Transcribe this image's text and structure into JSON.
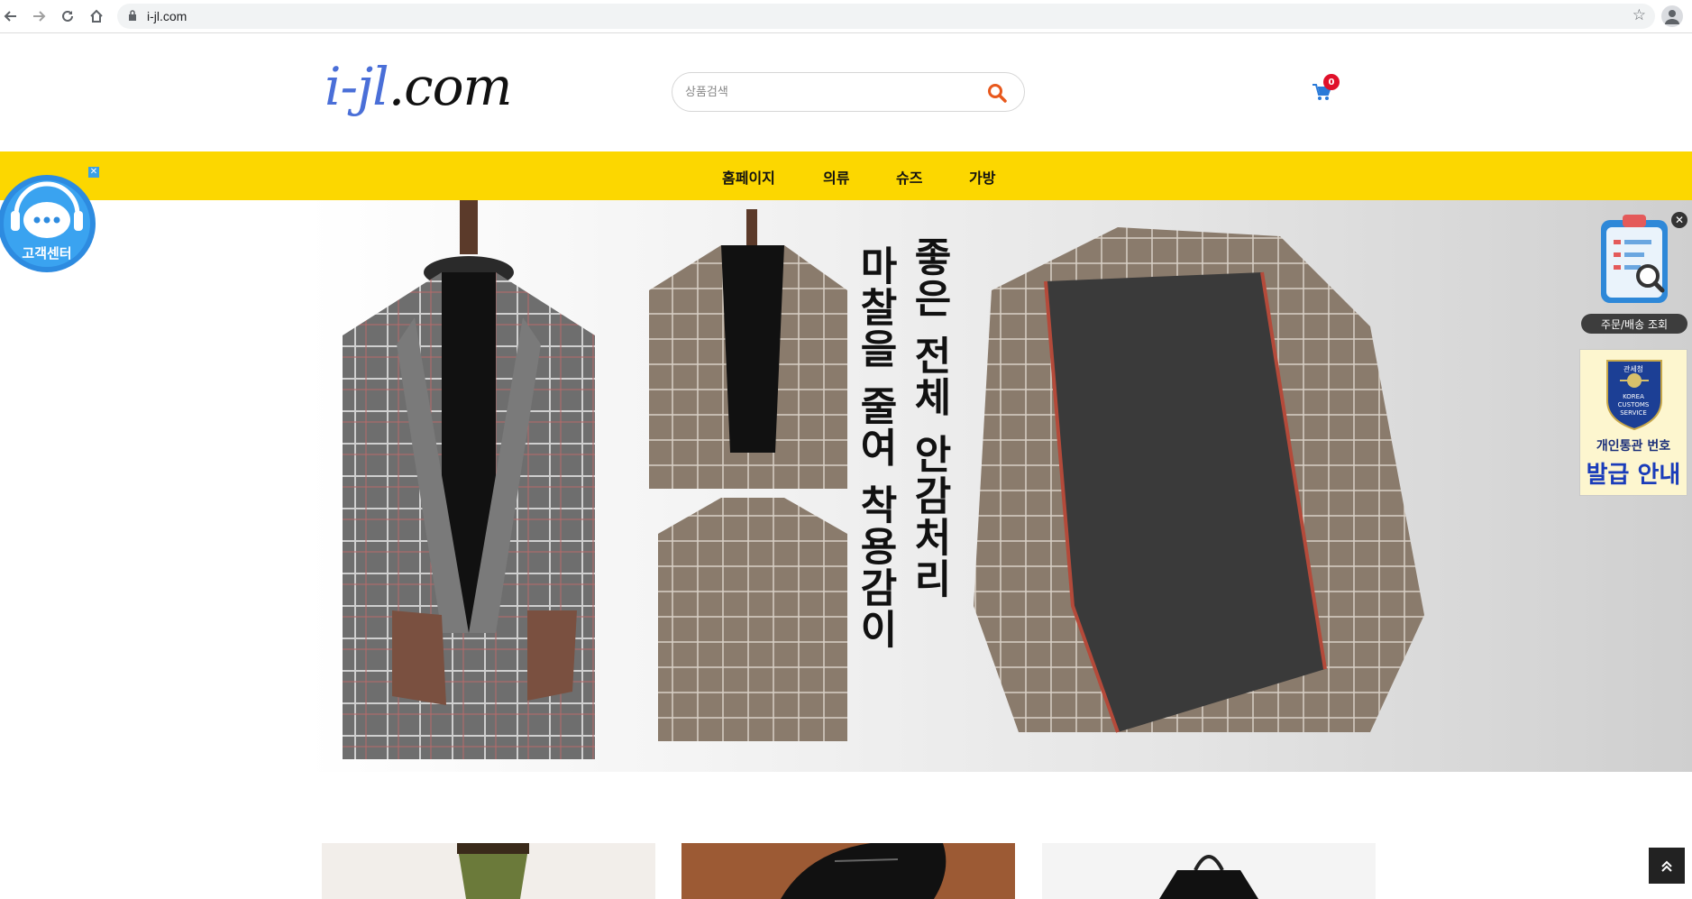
{
  "browser": {
    "url": "i-jl.com",
    "icons": [
      "back-icon",
      "forward-icon",
      "reload-icon",
      "home-icon",
      "lock-icon",
      "star-icon",
      "profile-icon"
    ]
  },
  "header": {
    "logo_part1": "i-jl",
    "logo_part2": ".com",
    "search_placeholder": "상품검색",
    "cart_count": "0"
  },
  "nav": {
    "items": [
      {
        "label": "홈페이지"
      },
      {
        "label": "의류"
      },
      {
        "label": "슈즈"
      },
      {
        "label": "가방"
      }
    ]
  },
  "banner": {
    "col1": "좋은 전체 안감처리",
    "col2": "마찰을 줄여 착용감이"
  },
  "widgets": {
    "cs_label": "고객센터",
    "order_label": "주문/배송 조회",
    "customs_badge_top": "관세청",
    "customs_badge_text1": "KOREA",
    "customs_badge_text2": "CUSTOMS",
    "customs_badge_text3": "SERVICE",
    "customs_line1": "개인통관 번호",
    "customs_line2": "발급 안내"
  },
  "colors": {
    "nav_bg": "#fcd700",
    "accent_search": "#e8581c",
    "cart": "#2a7ad8",
    "badge": "#e0102a",
    "cs_blue": "#2d8be0"
  }
}
